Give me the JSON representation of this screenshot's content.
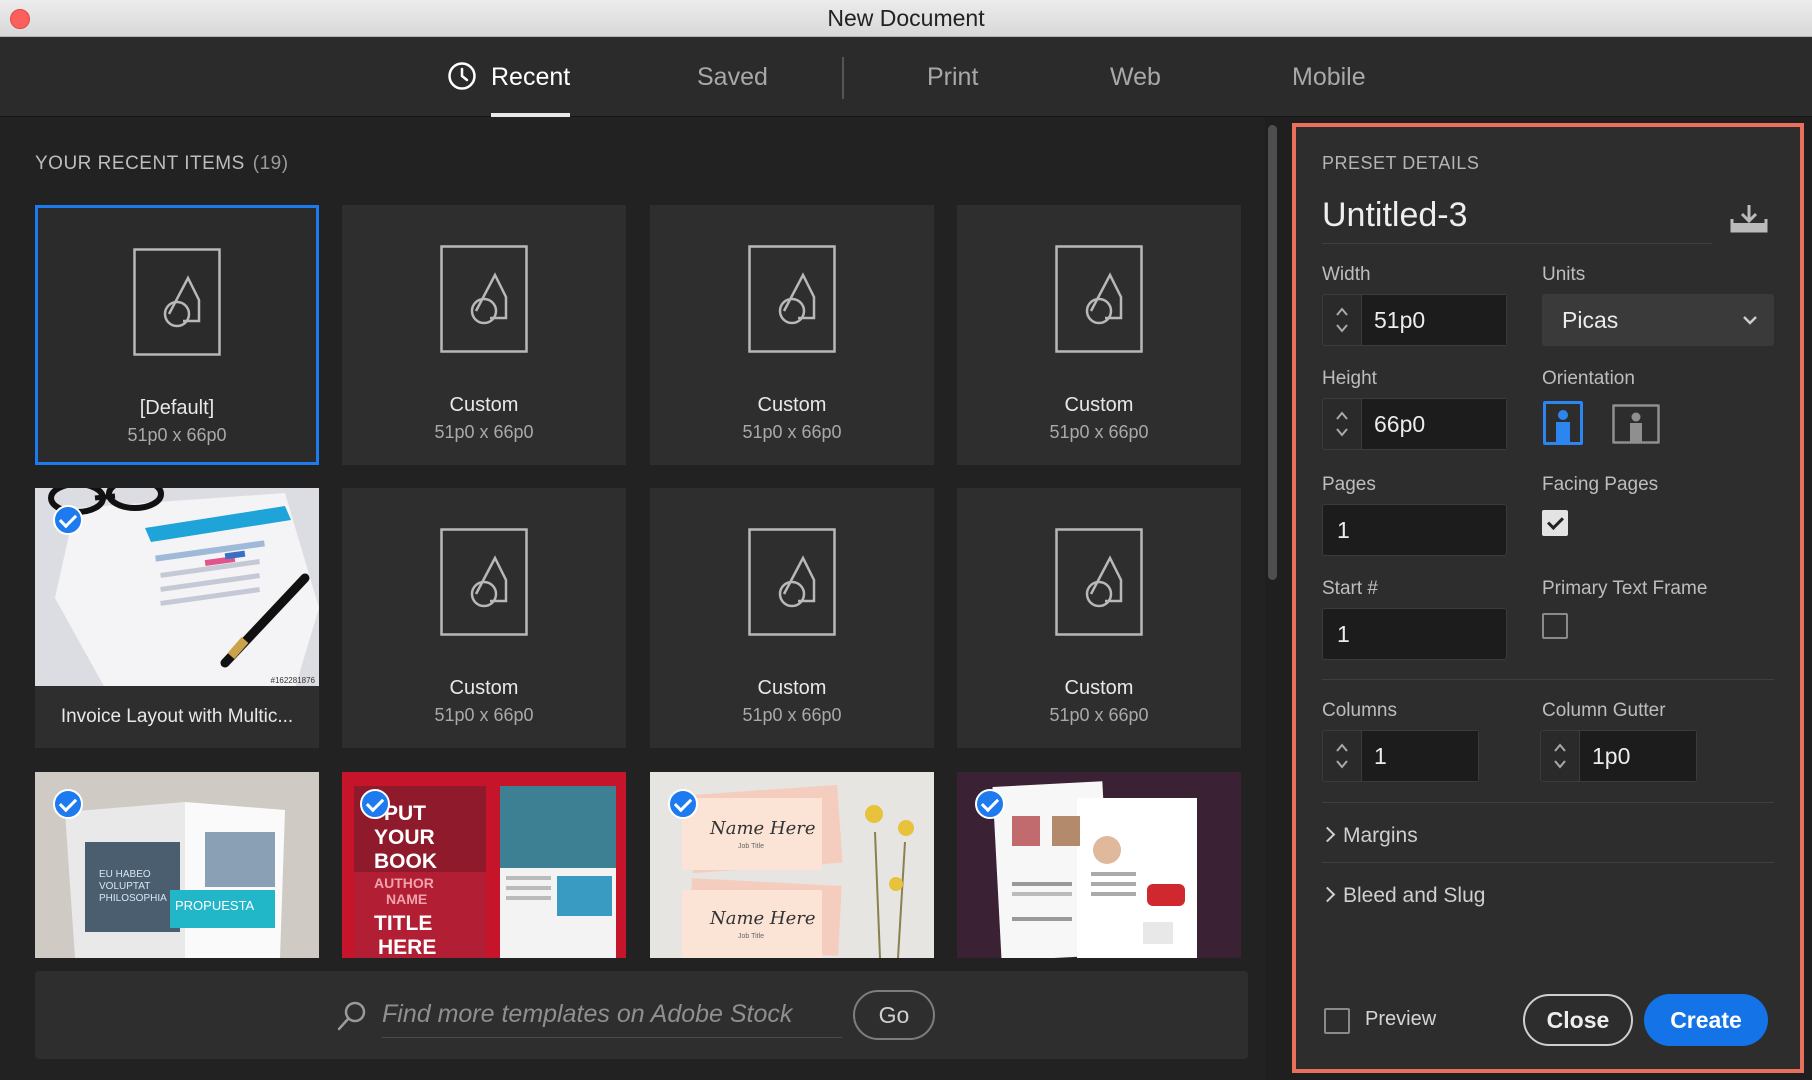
{
  "window": {
    "title": "New Document"
  },
  "tabs": [
    {
      "label": "Recent",
      "active": true,
      "icon": "clock-icon"
    },
    {
      "label": "Saved"
    },
    {
      "label": "Print"
    },
    {
      "label": "Web"
    },
    {
      "label": "Mobile"
    }
  ],
  "recent": {
    "heading": "YOUR RECENT ITEMS",
    "count": "(19)",
    "items": [
      {
        "name": "[Default]",
        "size": "51p0 x 66p0",
        "selected": true
      },
      {
        "name": "Custom",
        "size": "51p0 x 66p0"
      },
      {
        "name": "Custom",
        "size": "51p0 x 66p0"
      },
      {
        "name": "Custom",
        "size": "51p0 x 66p0"
      },
      {
        "name": "Invoice Layout with Multic...",
        "template": true,
        "checked": true
      },
      {
        "name": "Custom",
        "size": "51p0 x 66p0"
      },
      {
        "name": "Custom",
        "size": "51p0 x 66p0"
      },
      {
        "name": "Custom",
        "size": "51p0 x 66p0"
      }
    ],
    "templates_row3": [
      {
        "thumb_text": [
          "EU HABEO",
          "VOLUPTAT",
          "PHILOSOPHIA",
          "PROPUESTA"
        ],
        "checked": true
      },
      {
        "thumb_text": [
          "PUT",
          "YOUR",
          "BOOK",
          "AUTHOR",
          "NAME",
          "TITLE",
          "HERE"
        ],
        "checked": true
      },
      {
        "thumb_text": [
          "Name Here",
          "Job Title",
          "Name Here",
          "Job Title"
        ],
        "checked": true
      },
      {
        "thumb_text": [],
        "checked": true
      }
    ],
    "invoice_stock_id": "#162281876"
  },
  "search": {
    "placeholder": "Find more templates on Adobe Stock",
    "go_label": "Go"
  },
  "preset": {
    "heading": "PRESET DETAILS",
    "name": "Untitled-3",
    "width_label": "Width",
    "width_value": "51p0",
    "units_label": "Units",
    "units_value": "Picas",
    "height_label": "Height",
    "height_value": "66p0",
    "orientation_label": "Orientation",
    "orientation_value": "portrait",
    "pages_label": "Pages",
    "pages_value": "1",
    "facing_label": "Facing Pages",
    "facing_checked": true,
    "start_label": "Start #",
    "start_value": "1",
    "primary_frame_label": "Primary Text Frame",
    "primary_frame_checked": false,
    "columns_label": "Columns",
    "columns_value": "1",
    "gutter_label": "Column Gutter",
    "gutter_value": "1p0",
    "margins_label": "Margins",
    "bleed_label": "Bleed and Slug",
    "preview_label": "Preview",
    "close_label": "Close",
    "create_label": "Create"
  },
  "colors": {
    "accent": "#1473e6",
    "highlight_border": "#e8705d",
    "selection": "#1d7bef"
  }
}
